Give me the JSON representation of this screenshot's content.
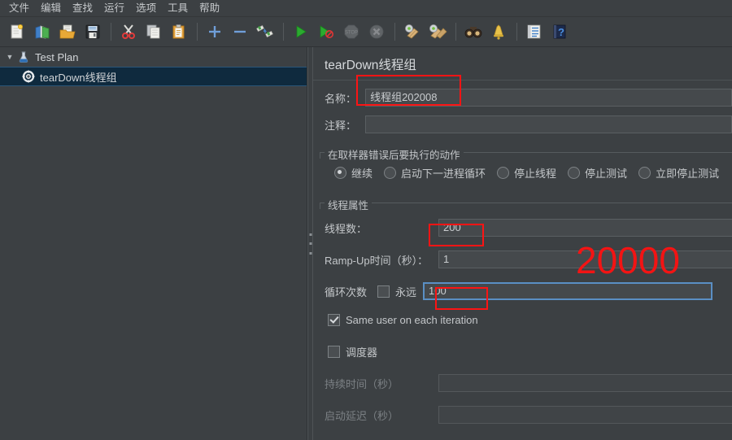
{
  "menubar": {
    "items": [
      {
        "label": "文件",
        "name": "menu-file"
      },
      {
        "label": "编辑",
        "name": "menu-edit"
      },
      {
        "label": "查找",
        "name": "menu-search"
      },
      {
        "label": "运行",
        "name": "menu-run"
      },
      {
        "label": "选项",
        "name": "menu-options"
      },
      {
        "label": "工具",
        "name": "menu-tools"
      },
      {
        "label": "帮助",
        "name": "menu-help"
      }
    ]
  },
  "toolbar": {
    "buttons": [
      {
        "icon": "new-document-icon",
        "enabled": true
      },
      {
        "icon": "templates-icon",
        "enabled": true
      },
      {
        "icon": "open-folder-icon",
        "enabled": true
      },
      {
        "icon": "save-icon",
        "enabled": true
      },
      {
        "icon": "cut-scissors-icon",
        "enabled": true
      },
      {
        "icon": "copy-icon",
        "enabled": true
      },
      {
        "icon": "paste-clipboard-icon",
        "enabled": true
      },
      {
        "icon": "plus-expand-icon",
        "enabled": true
      },
      {
        "icon": "minus-collapse-icon",
        "enabled": true
      },
      {
        "icon": "toggle-icon",
        "enabled": true
      },
      {
        "icon": "start-play-icon",
        "enabled": true
      },
      {
        "icon": "start-no-timers-icon",
        "enabled": true
      },
      {
        "icon": "stop-icon",
        "enabled": false
      },
      {
        "icon": "shutdown-icon",
        "enabled": false
      },
      {
        "icon": "clear-icon",
        "enabled": true
      },
      {
        "icon": "clear-all-icon",
        "enabled": true
      },
      {
        "icon": "search-binoculars-icon",
        "enabled": true
      },
      {
        "icon": "function-helper-icon",
        "enabled": true
      },
      {
        "icon": "templates-list-icon",
        "enabled": true
      },
      {
        "icon": "help-book-icon",
        "enabled": true
      }
    ]
  },
  "tree": {
    "root": {
      "label": "Test Plan",
      "icon": "test-plan-icon",
      "expanded": true
    },
    "children": [
      {
        "label": "tearDown线程组",
        "icon": "teardown-thread-group-icon",
        "selected": true
      }
    ]
  },
  "panel": {
    "title": "tearDown线程组",
    "name_label": "名称：",
    "name_value": "线程组202008",
    "comment_label": "注释：",
    "comment_value": "",
    "error_action": {
      "group_title": "在取样器错误后要执行的动作",
      "options": [
        {
          "label": "继续",
          "selected": true
        },
        {
          "label": "启动下一进程循环",
          "selected": false
        },
        {
          "label": "停止线程",
          "selected": false
        },
        {
          "label": "停止测试",
          "selected": false
        },
        {
          "label": "立即停止测试",
          "selected": false
        }
      ]
    },
    "thread_properties": {
      "group_title": "线程属性",
      "threads_label": "线程数：",
      "threads_value": "200",
      "rampup_label": "Ramp-Up时间（秒）：",
      "rampup_value": "1",
      "loops_label": "循环次数",
      "forever_label": "永远",
      "forever_checked": false,
      "loops_value": "100",
      "same_user_label": "Same user on each iteration",
      "same_user_checked": true,
      "scheduler_label": "调度器",
      "scheduler_checked": false,
      "duration_label": "持续时间（秒）",
      "duration_value": "",
      "duration_enabled": false,
      "startup_delay_label": "启动延迟（秒）",
      "startup_delay_value": "",
      "startup_delay_enabled": false
    }
  },
  "annotations": {
    "big_number": "20000",
    "boxes": [
      {
        "target": "name-field",
        "color": "#fc1414"
      },
      {
        "target": "threads-field",
        "color": "#fc1414"
      },
      {
        "target": "loops-field",
        "color": "#fc1414"
      }
    ]
  },
  "colors": {
    "panel_bg": "#3c4043",
    "selection_bg": "#0f2a3e",
    "accent_focus": "#5a8fc4",
    "annotation_red": "#fc1414",
    "text": "#c9cccf"
  }
}
